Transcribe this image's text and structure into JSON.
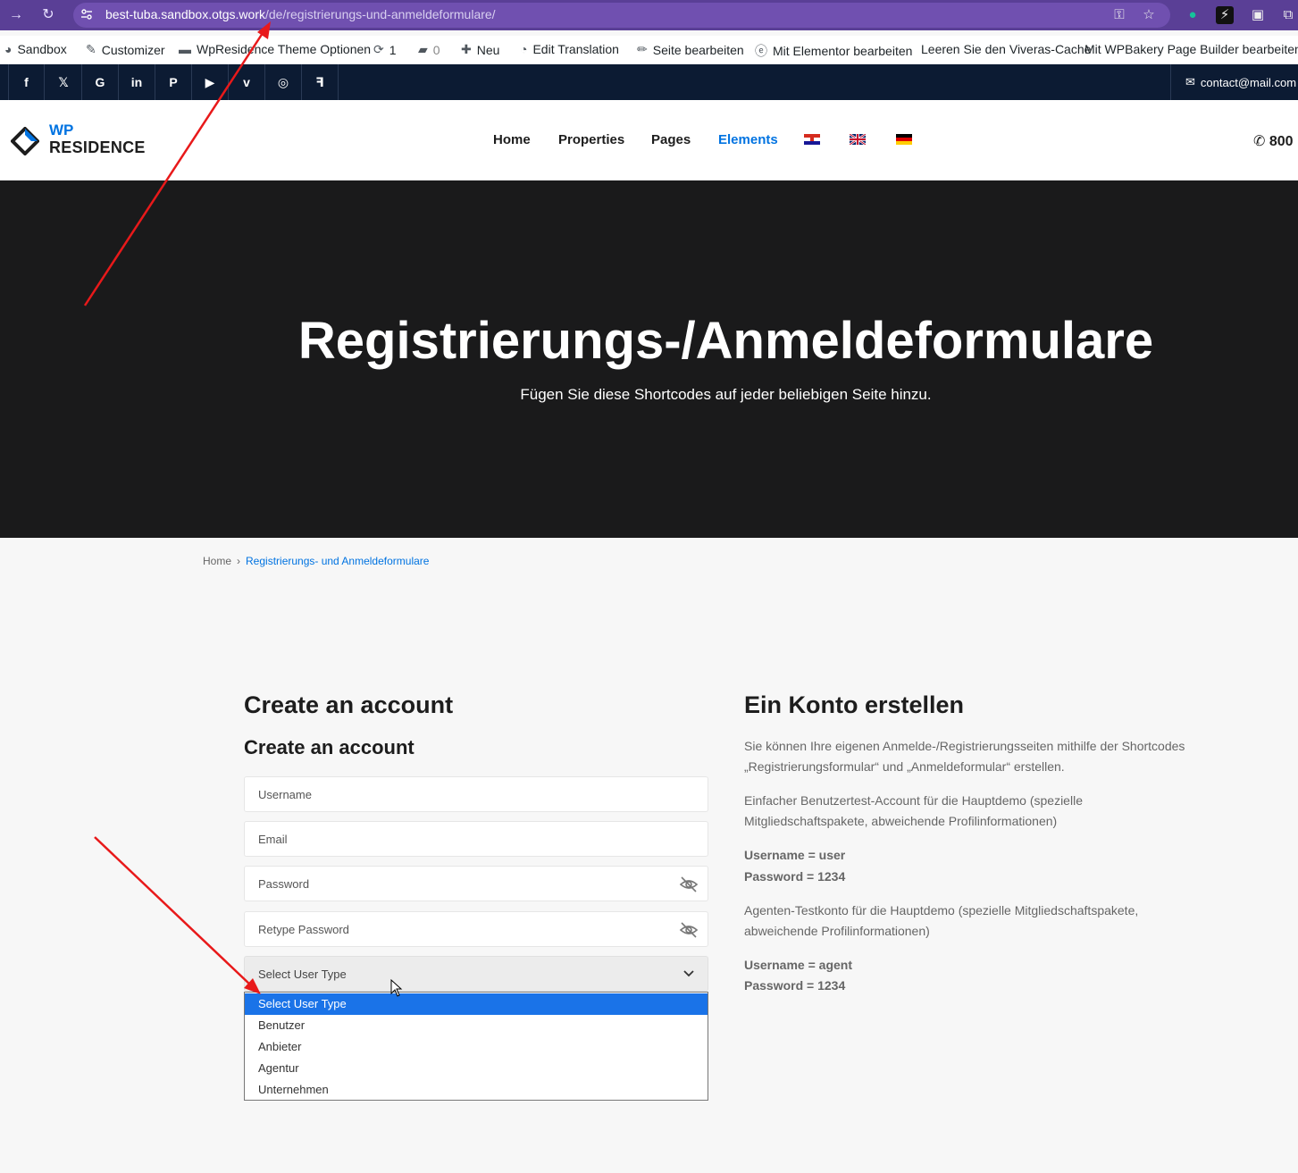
{
  "browser": {
    "url_host": "best-tuba.sandbox.otgs.work",
    "url_path": "/de/registrierungs-und-anmeldeformulare/"
  },
  "admin_bar": {
    "items": [
      {
        "label": "Sandbox",
        "icon": "dashboard-icon"
      },
      {
        "label": "Customizer",
        "icon": "brush-icon"
      },
      {
        "label": "WpResidence Theme Optionen",
        "icon": "folder-icon"
      },
      {
        "label": "1",
        "icon": "update-icon"
      },
      {
        "label": "0",
        "icon": "comment-icon"
      },
      {
        "label": "Neu",
        "icon": "plus-icon"
      },
      {
        "label": "Edit Translation",
        "icon": "translate-icon"
      },
      {
        "label": "Seite bearbeiten",
        "icon": "pencil-icon"
      },
      {
        "label": "Mit Elementor bearbeiten",
        "icon": "elementor-icon"
      },
      {
        "label": "Leeren Sie den Viveras-Cache",
        "icon": ""
      },
      {
        "label": "Mit WPBakery Page Builder bearbeiten",
        "icon": ""
      }
    ]
  },
  "topbar": {
    "social": [
      "facebook-icon",
      "x-icon",
      "google-icon",
      "linkedin-icon",
      "pinterest-icon",
      "youtube-icon",
      "vimeo-icon",
      "instagram-icon",
      "foursquare-icon"
    ],
    "email": "contact@mail.com"
  },
  "header": {
    "logo_wp": "WP",
    "logo_residence": "RESIDENCE",
    "menu": [
      "Home",
      "Properties",
      "Pages",
      "Elements"
    ],
    "phone": "800"
  },
  "hero": {
    "title": "Registrierungs-/Anmeldeformulare",
    "subtitle": "Fügen Sie diese Shortcodes auf jeder beliebigen Seite hinzu."
  },
  "breadcrumb": {
    "home": "Home",
    "current": "Registrierungs- und Anmeldeformulare"
  },
  "form": {
    "heading": "Create an account",
    "subheading": "Create an account",
    "username_placeholder": "Username",
    "email_placeholder": "Email",
    "password_placeholder": "Password",
    "retype_placeholder": "Retype Password",
    "user_type_selected": "Select User Type",
    "user_type_options": [
      "Select User Type",
      "Benutzer",
      "Anbieter",
      "Agentur",
      "Unternehmen"
    ]
  },
  "info": {
    "heading": "Ein Konto erstellen",
    "p1_line1": "Sie können Ihre eigenen Anmelde-/Registrierungsseiten mithilfe der Shortcodes",
    "p1_line2": "„Registrierungsformular“ und „Anmeldeformular“ erstellen.",
    "p2_line1": "Einfacher Benutzertest-Account für die Hauptdemo (spezielle",
    "p2_line2": "Mitgliedschaftspakete, abweichende Profilinformationen)",
    "user_username": "Username = user",
    "user_password": "Password = 1234",
    "p3_line1": "Agenten-Testkonto für die Hauptdemo (spezielle Mitgliedschaftspakete,",
    "p3_line2": "abweichende Profilinformationen)",
    "agent_username": "Username = agent",
    "agent_password": "Password = 1234"
  },
  "colors": {
    "accent": "#0073e1",
    "browser": "#5a3f96",
    "topbar": "#0c1b33",
    "hero": "#1a1a1b",
    "annotation": "#e8191a"
  }
}
